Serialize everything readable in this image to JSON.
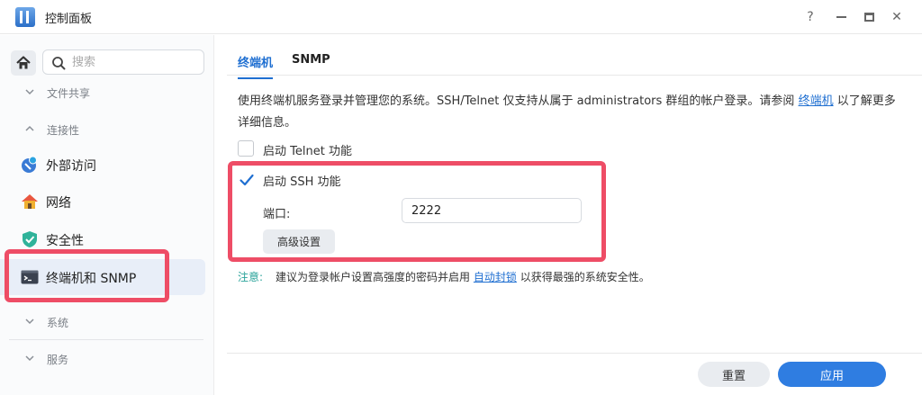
{
  "window": {
    "title": "控制面板",
    "help_symbol": "?",
    "close_symbol": "✕"
  },
  "sidebar": {
    "search": {
      "placeholder": "搜索",
      "value": ""
    },
    "sections": [
      {
        "label": "文件共享",
        "expanded": false
      },
      {
        "label": "连接性",
        "expanded": true
      },
      {
        "label": "系统",
        "expanded": false
      },
      {
        "label": "服务",
        "expanded": false
      }
    ],
    "items": [
      {
        "label": "外部访问",
        "icon": "external-access-icon"
      },
      {
        "label": "网络",
        "icon": "network-house-icon"
      },
      {
        "label": "安全性",
        "icon": "shield-icon"
      },
      {
        "label": "终端机和 SNMP",
        "icon": "terminal-icon",
        "active": true
      }
    ]
  },
  "tabs": [
    {
      "label": "终端机",
      "active": true
    },
    {
      "label": "SNMP",
      "active": false
    }
  ],
  "main": {
    "description_before": "使用终端机服务登录并管理您的系统。SSH/Telnet 仅支持从属于 administrators 群组的帐户登录。请参阅 ",
    "description_link": "终端机",
    "description_after": " 以了解更多详细信息。",
    "telnet_label": "启动 Telnet 功能",
    "telnet_checked": false,
    "ssh_label": "启动 SSH 功能",
    "ssh_checked": true,
    "port_label": "端口:",
    "port_value": "2222",
    "advanced_button": "高级设置",
    "note_label": "注意:",
    "note_text_before": "建议为登录帐户设置高强度的密码并启用 ",
    "note_link": "自动封锁",
    "note_text_after": " 以获得最强的系统安全性。"
  },
  "footer": {
    "reset_label": "重置",
    "apply_label": "应用"
  },
  "colors": {
    "accent": "#1f6fd1",
    "highlight": "#ee4d66",
    "note": "#2aa39a",
    "apply_button": "#2f7de1"
  }
}
